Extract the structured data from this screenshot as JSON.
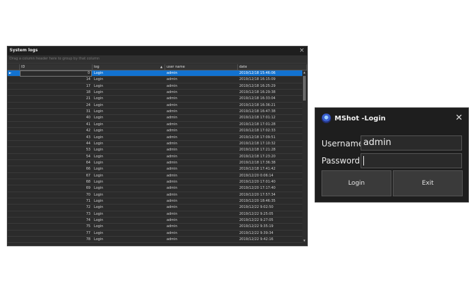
{
  "logs_window": {
    "title": "System logs",
    "close_glyph": "×",
    "group_hint": "Drag a column header here to group by that column",
    "columns": [
      "ID",
      "log",
      "user name",
      "date"
    ],
    "sort": {
      "column": "log",
      "direction": "ascending",
      "glyph": "▲"
    },
    "row_indicator": "►",
    "scroll_up": "▲",
    "scroll_down": "▼",
    "rows": [
      {
        "id": "0",
        "log": "Login",
        "user": "admin",
        "date": "2019/12/18 15:46:06"
      },
      {
        "id": "14",
        "log": "Login",
        "user": "admin",
        "date": "2019/12/18 16:15:09"
      },
      {
        "id": "17",
        "log": "Login",
        "user": "admin",
        "date": "2019/12/18 16:25:29"
      },
      {
        "id": "18",
        "log": "Login",
        "user": "admin",
        "date": "2019/12/18 16:29:38"
      },
      {
        "id": "21",
        "log": "Login",
        "user": "admin",
        "date": "2019/12/18 16:33:04"
      },
      {
        "id": "24",
        "log": "Login",
        "user": "admin",
        "date": "2019/12/18 16:36:21"
      },
      {
        "id": "31",
        "log": "Login",
        "user": "admin",
        "date": "2019/12/18 16:47:38"
      },
      {
        "id": "40",
        "log": "Login",
        "user": "admin",
        "date": "2019/12/18 17:01:12"
      },
      {
        "id": "41",
        "log": "Login",
        "user": "admin",
        "date": "2019/12/18 17:01:28"
      },
      {
        "id": "42",
        "log": "Login",
        "user": "admin",
        "date": "2019/12/18 17:02:33"
      },
      {
        "id": "43",
        "log": "Login",
        "user": "admin",
        "date": "2019/12/18 17:09:51"
      },
      {
        "id": "44",
        "log": "Login",
        "user": "admin",
        "date": "2019/12/18 17:10:32"
      },
      {
        "id": "53",
        "log": "Login",
        "user": "admin",
        "date": "2019/12/18 17:21:28"
      },
      {
        "id": "54",
        "log": "Login",
        "user": "admin",
        "date": "2019/12/18 17:23:20"
      },
      {
        "id": "64",
        "log": "Login",
        "user": "admin",
        "date": "2019/12/18 17:36:38"
      },
      {
        "id": "66",
        "log": "Login",
        "user": "admin",
        "date": "2019/12/18 17:41:42"
      },
      {
        "id": "67",
        "log": "Login",
        "user": "admin",
        "date": "2019/12/20 0:06:14"
      },
      {
        "id": "68",
        "log": "Login",
        "user": "admin",
        "date": "2019/12/20 17:01:40"
      },
      {
        "id": "69",
        "log": "Login",
        "user": "admin",
        "date": "2019/12/20 17:17:40"
      },
      {
        "id": "70",
        "log": "Login",
        "user": "admin",
        "date": "2019/12/20 17:57:34"
      },
      {
        "id": "71",
        "log": "Login",
        "user": "admin",
        "date": "2019/12/20 18:46:35"
      },
      {
        "id": "72",
        "log": "Login",
        "user": "admin",
        "date": "2019/12/22 9:02:50"
      },
      {
        "id": "73",
        "log": "Login",
        "user": "admin",
        "date": "2019/12/22 9:25:05"
      },
      {
        "id": "74",
        "log": "Login",
        "user": "admin",
        "date": "2019/12/22 9:27:05"
      },
      {
        "id": "75",
        "log": "Login",
        "user": "admin",
        "date": "2019/12/22 9:35:19"
      },
      {
        "id": "77",
        "log": "Login",
        "user": "admin",
        "date": "2019/12/22 9:39:34"
      },
      {
        "id": "78",
        "log": "Login",
        "user": "admin",
        "date": "2019/12/22 9:42:16"
      }
    ],
    "selected_row": 0,
    "selected_color": "#1272d0"
  },
  "login_dialog": {
    "title": "MShot -Login",
    "close_glyph": "✕",
    "username_label": "Username",
    "username_value": "admin",
    "password_label": "Password",
    "password_value": "",
    "login_button": "Login",
    "exit_button": "Exit"
  }
}
